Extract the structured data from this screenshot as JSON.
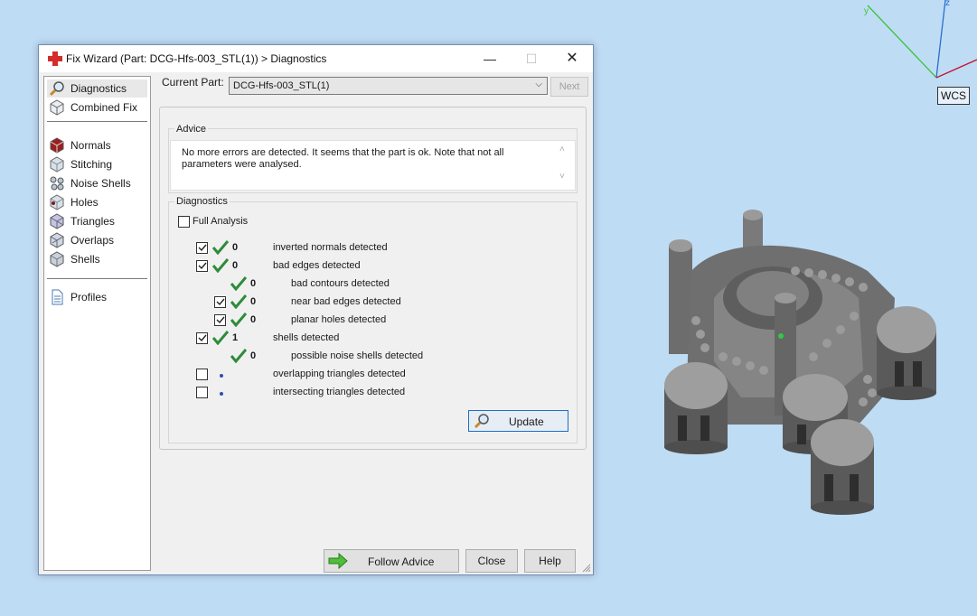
{
  "window": {
    "title": "Fix Wizard (Part: DCG-Hfs-003_STL(1)) > Diagnostics",
    "minimize_glyph": "—",
    "maximize_glyph": "☐",
    "close_glyph": "✕"
  },
  "nav": {
    "items": [
      {
        "label": "Diagnostics",
        "icon": "magnifier-icon",
        "selected": true
      },
      {
        "label": "Combined Fix",
        "icon": "cube-icon"
      },
      {
        "label": "Normals",
        "icon": "normals-cube-icon"
      },
      {
        "label": "Stitching",
        "icon": "stitching-cube-icon"
      },
      {
        "label": "Noise Shells",
        "icon": "noise-shells-icon"
      },
      {
        "label": "Holes",
        "icon": "holes-cube-icon"
      },
      {
        "label": "Triangles",
        "icon": "triangles-cube-icon"
      },
      {
        "label": "Overlaps",
        "icon": "overlaps-cube-icon"
      },
      {
        "label": "Shells",
        "icon": "shells-cube-icon"
      },
      {
        "label": "Profiles",
        "icon": "document-icon"
      }
    ]
  },
  "current_part": {
    "label": "Current Part:",
    "value": "DCG-Hfs-003_STL(1)",
    "next_label": "Next"
  },
  "advice": {
    "group_label": "Advice",
    "text": "No more errors are detected. It seems that the part is ok. Note that not all parameters were analysed."
  },
  "diagnostics": {
    "group_label": "Diagnostics",
    "full_analysis_label": "Full Analysis",
    "full_analysis_checked": false,
    "rows": [
      {
        "count": "0",
        "label": "inverted normals detected",
        "checkbox": true,
        "checked": true,
        "status": "ok"
      },
      {
        "count": "0",
        "label": "bad edges detected",
        "checkbox": true,
        "checked": true,
        "status": "ok"
      },
      {
        "count": "0",
        "label": "bad contours detected",
        "checkbox": false,
        "status": "ok"
      },
      {
        "count": "0",
        "label": "near bad edges detected",
        "checkbox": true,
        "checked": true,
        "status": "ok"
      },
      {
        "count": "0",
        "label": "planar holes detected",
        "checkbox": true,
        "checked": true,
        "status": "ok"
      },
      {
        "count": "1",
        "label": "shells detected",
        "checkbox": true,
        "checked": true,
        "status": "ok"
      },
      {
        "count": "0",
        "label": "possible noise shells detected",
        "checkbox": false,
        "status": "ok"
      },
      {
        "count": "",
        "label": "overlapping triangles detected",
        "checkbox": true,
        "checked": false,
        "status": "pending"
      },
      {
        "count": "",
        "label": "intersecting triangles detected",
        "checkbox": true,
        "checked": false,
        "status": "pending"
      }
    ],
    "update_label": "Update"
  },
  "buttons": {
    "follow_advice": "Follow Advice",
    "close": "Close",
    "help": "Help"
  },
  "viewport": {
    "wcs_label": "WCS",
    "axis_y_label": "y",
    "axis_z_label": "z"
  },
  "colors": {
    "check_green": "#2e8b3a",
    "dialog_bg": "#f0f0f0",
    "viewport_bg": "#bfdcf5",
    "axis_x": "#c8102e",
    "axis_y": "#3cc43c",
    "axis_z": "#2a6fd0"
  }
}
